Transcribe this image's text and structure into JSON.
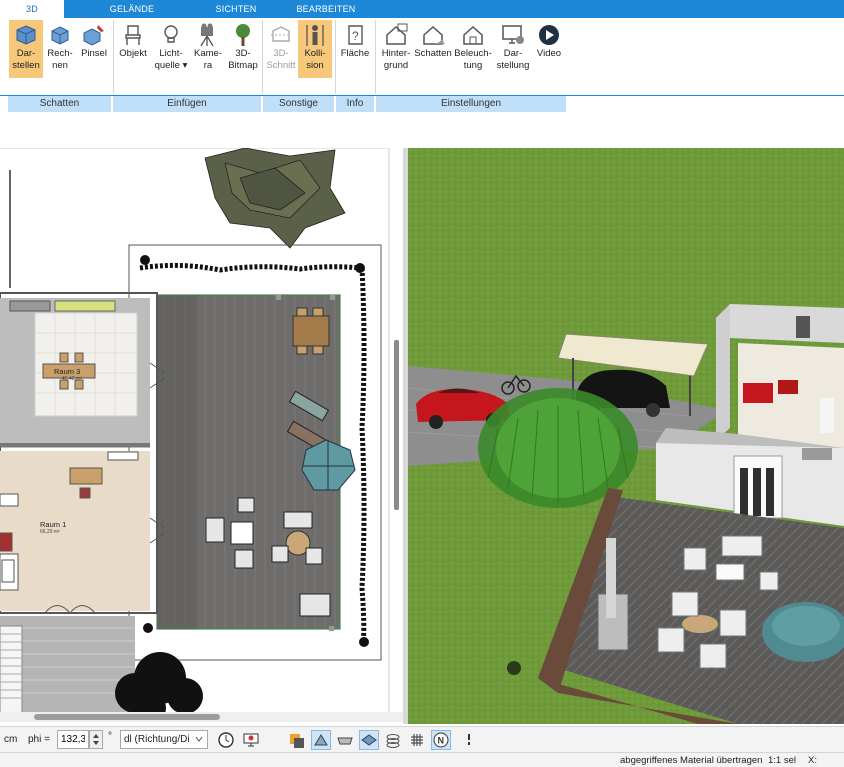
{
  "tabs": [
    {
      "label": "3D"
    },
    {
      "label": "GELÄNDE"
    },
    {
      "label": "SICHTEN"
    },
    {
      "label": "BEARBEITEN"
    }
  ],
  "ribbon": {
    "buttons": [
      {
        "line1": "Dar-",
        "line2": "stellen",
        "icon": "cube-render-icon"
      },
      {
        "line1": "Rech-",
        "line2": "nen",
        "icon": "cube-calc-icon"
      },
      {
        "line1": "Pinsel",
        "line2": "",
        "icon": "cube-brush-icon"
      },
      {
        "line1": "Objekt",
        "line2": "",
        "icon": "chair-icon"
      },
      {
        "line1": "Licht-",
        "line2": "quelle ▾",
        "icon": "light-bulb-icon"
      },
      {
        "line1": "Kame-",
        "line2": "ra",
        "icon": "camera-icon"
      },
      {
        "line1": "3D-",
        "line2": "Bitmap",
        "icon": "tree-icon"
      },
      {
        "line1": "3D-",
        "line2": "Schnitt",
        "icon": "section-icon"
      },
      {
        "line1": "Kolli-",
        "line2": "sion",
        "icon": "person-collision-icon"
      },
      {
        "line1": "Fläche",
        "line2": "",
        "icon": "area-question-icon"
      },
      {
        "line1": "Hinter-",
        "line2": "grund",
        "icon": "house-background-icon"
      },
      {
        "line1": "Schatten",
        "line2": "",
        "icon": "house-shadow-icon"
      },
      {
        "line1": "Beleuch-",
        "line2": "tung",
        "icon": "house-light-icon"
      },
      {
        "line1": "Dar-",
        "line2": "stellung",
        "icon": "monitor-settings-icon"
      },
      {
        "line1": "Video",
        "line2": "",
        "icon": "play-video-icon"
      }
    ],
    "groups": [
      {
        "label": "Schatten"
      },
      {
        "label": "Einfügen"
      },
      {
        "label": "Sonstige"
      },
      {
        "label": "Info"
      },
      {
        "label": "Einstellungen"
      }
    ]
  },
  "plan": {
    "rooms": [
      {
        "name": "Raum 3",
        "area": "45,42 m²"
      },
      {
        "name": "Raum 1",
        "area": "66,29 m²"
      }
    ]
  },
  "toolbar": {
    "unit": "cm",
    "phi_label": "phi =",
    "phi_value": "132,32",
    "degree": "°",
    "dl_value": "dl (Richtung/Di",
    "icons": [
      "clock-icon",
      "monitor-icon",
      "layers-icon",
      "cursor-snap-icon",
      "hatch-icon",
      "surface-icon",
      "stack-icon",
      "grid-icon",
      "north-icon",
      "more-icon"
    ]
  },
  "status": {
    "message": "abgegriffenes Material übertragen",
    "scale": "1:1 sel",
    "coord_label": "X:"
  },
  "colors": {
    "accent": "#1e88d8",
    "group_bar": "#bfe0f8",
    "selected": "#f7c77a",
    "grass": "#6f9a3a"
  }
}
